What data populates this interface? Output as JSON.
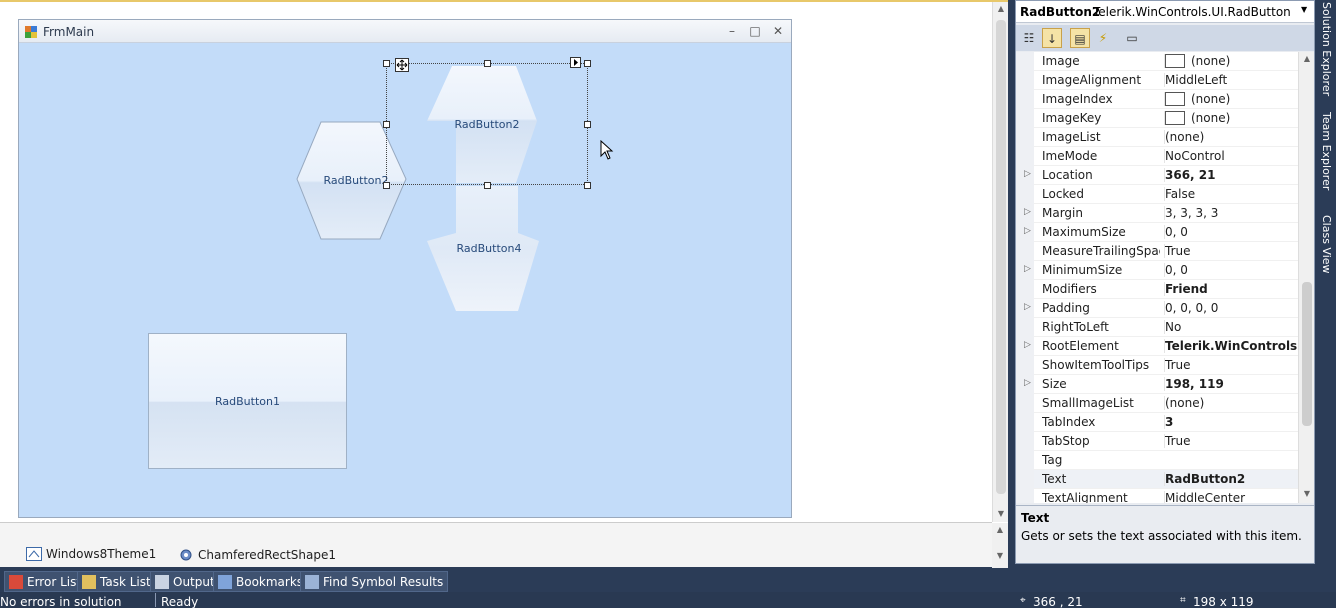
{
  "form": {
    "title": "FrmMain",
    "minimize_glyph": "–",
    "maximize_glyph": "□",
    "close_glyph": "✕"
  },
  "buttons": {
    "radbutton1": "RadButton1",
    "radbutton2": "RadButton2",
    "radbutton2_copy": "RadButton2",
    "radbutton4": "RadButton4"
  },
  "tray": {
    "items": [
      "Windows8Theme1",
      "ChamferedRectShape1"
    ]
  },
  "bottom_tabs": [
    "Error List",
    "Task List",
    "Output",
    "Bookmarks",
    "Find Symbol Results"
  ],
  "status": {
    "left": "No errors in solution",
    "ready": "Ready",
    "position": "366 , 21",
    "size": "198 x 119"
  },
  "properties": {
    "object_name": "RadButton2",
    "object_type": "Telerik.WinControls.UI.RadButton",
    "rows": [
      {
        "name": "Image",
        "value": "(none)",
        "swatch": true,
        "expand": false,
        "bold": false
      },
      {
        "name": "ImageAlignment",
        "value": "MiddleLeft",
        "swatch": false,
        "expand": false,
        "bold": false
      },
      {
        "name": "ImageIndex",
        "value": "(none)",
        "swatch": true,
        "expand": false,
        "bold": false
      },
      {
        "name": "ImageKey",
        "value": "(none)",
        "swatch": true,
        "expand": false,
        "bold": false
      },
      {
        "name": "ImageList",
        "value": "(none)",
        "swatch": false,
        "expand": false,
        "bold": false
      },
      {
        "name": "ImeMode",
        "value": "NoControl",
        "swatch": false,
        "expand": false,
        "bold": false
      },
      {
        "name": "Location",
        "value": "366, 21",
        "swatch": false,
        "expand": true,
        "bold": true
      },
      {
        "name": "Locked",
        "value": "False",
        "swatch": false,
        "expand": false,
        "bold": false
      },
      {
        "name": "Margin",
        "value": "3, 3, 3, 3",
        "swatch": false,
        "expand": true,
        "bold": false
      },
      {
        "name": "MaximumSize",
        "value": "0, 0",
        "swatch": false,
        "expand": true,
        "bold": false
      },
      {
        "name": "MeasureTrailingSpaces",
        "value": "True",
        "swatch": false,
        "expand": false,
        "bold": false
      },
      {
        "name": "MinimumSize",
        "value": "0, 0",
        "swatch": false,
        "expand": true,
        "bold": false
      },
      {
        "name": "Modifiers",
        "value": "Friend",
        "swatch": false,
        "expand": false,
        "bold": true
      },
      {
        "name": "Padding",
        "value": "0, 0, 0, 0",
        "swatch": false,
        "expand": true,
        "bold": false
      },
      {
        "name": "RightToLeft",
        "value": "No",
        "swatch": false,
        "expand": false,
        "bold": false
      },
      {
        "name": "RootElement",
        "value": "Telerik.WinControls.RootRadElement",
        "swatch": false,
        "expand": true,
        "bold": true
      },
      {
        "name": "ShowItemToolTips",
        "value": "True",
        "swatch": false,
        "expand": false,
        "bold": false
      },
      {
        "name": "Size",
        "value": "198, 119",
        "swatch": false,
        "expand": true,
        "bold": true
      },
      {
        "name": "SmallImageList",
        "value": "(none)",
        "swatch": false,
        "expand": false,
        "bold": false
      },
      {
        "name": "TabIndex",
        "value": "3",
        "swatch": false,
        "expand": false,
        "bold": true
      },
      {
        "name": "TabStop",
        "value": "True",
        "swatch": false,
        "expand": false,
        "bold": false
      },
      {
        "name": "Tag",
        "value": "",
        "swatch": false,
        "expand": false,
        "bold": false
      },
      {
        "name": "Text",
        "value": "RadButton2",
        "swatch": false,
        "expand": false,
        "bold": true
      },
      {
        "name": "TextAlignment",
        "value": "MiddleCenter",
        "swatch": false,
        "expand": false,
        "bold": false
      }
    ],
    "description_title": "Text",
    "description_text": "Gets or sets the text associated with this item."
  },
  "right_dock": [
    "Solution Explorer",
    "Team Explorer",
    "Class View"
  ]
}
